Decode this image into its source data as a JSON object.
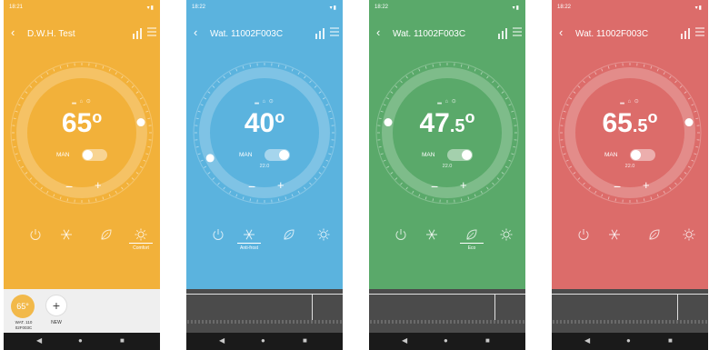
{
  "phones": [
    {
      "color": "#f2b13a",
      "time": "18:21",
      "title": "D.W.H. Test",
      "mini_icons": "▂ ⌂ ⊙",
      "temp_main": "65",
      "temp_decimal": "",
      "mode_label": "MAN",
      "humidity": "",
      "minus": "−",
      "plus": "+",
      "active_mode": 3,
      "modes": [
        {
          "icon": "power-icon",
          "label": ""
        },
        {
          "icon": "snowflake-icon",
          "label": ""
        },
        {
          "icon": "leaf-icon",
          "label": ""
        },
        {
          "icon": "sun-icon",
          "label": "Comfort"
        }
      ],
      "bottom": {
        "device_temp": "65°",
        "device_label": "WAT. 110\n02F003C",
        "new_plus": "+",
        "new_label": "NEW"
      }
    },
    {
      "color": "#5bb3de",
      "time": "18:22",
      "title": "Wat. 11002F003C",
      "mini_icons": "▂ ⌂ ⊙",
      "temp_main": "40",
      "temp_decimal": "",
      "mode_label": "MAN",
      "humidity": "22.0",
      "minus": "−",
      "plus": "+",
      "active_mode": 1,
      "modes": [
        {
          "icon": "power-icon",
          "label": ""
        },
        {
          "icon": "snowflake-icon",
          "label": "Anti-frost"
        },
        {
          "icon": "leaf-icon",
          "label": ""
        },
        {
          "icon": "sun-icon",
          "label": ""
        }
      ]
    },
    {
      "color": "#5aa96a",
      "time": "18:22",
      "title": "Wat. 11002F003C",
      "mini_icons": "▂ ⌂ ⊙",
      "temp_main": "47",
      "temp_decimal": ".5",
      "mode_label": "MAN",
      "humidity": "22.0",
      "minus": "−",
      "plus": "+",
      "active_mode": 2,
      "modes": [
        {
          "icon": "power-icon",
          "label": ""
        },
        {
          "icon": "snowflake-icon",
          "label": ""
        },
        {
          "icon": "leaf-icon",
          "label": "Eco"
        },
        {
          "icon": "sun-icon",
          "label": ""
        }
      ]
    },
    {
      "color": "#dc6c6a",
      "time": "18:22",
      "title": "Wat. 11002F003C",
      "mini_icons": "▂ ⌂ ⊙",
      "temp_main": "65",
      "temp_decimal": ".5",
      "mode_label": "MAN",
      "humidity": "22.0",
      "minus": "−",
      "plus": "+",
      "active_mode": -1,
      "modes": [
        {
          "icon": "power-icon",
          "label": ""
        },
        {
          "icon": "snowflake-icon",
          "label": ""
        },
        {
          "icon": "leaf-icon",
          "label": ""
        },
        {
          "icon": "sun-icon",
          "label": ""
        }
      ]
    }
  ],
  "nav": {
    "back": "◀",
    "home": "●",
    "recents": "■"
  }
}
